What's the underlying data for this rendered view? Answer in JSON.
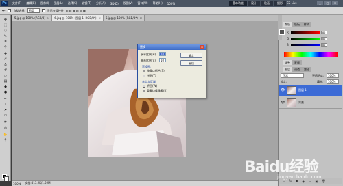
{
  "app": {
    "logo": "Ps",
    "menu": [
      "文件(F)",
      "编辑(E)",
      "图像(I)",
      "图层(L)",
      "选择(S)",
      "滤镜(T)",
      "分析(A)",
      "3D(D)",
      "视图(V)",
      "窗口(W)",
      "帮助(H)"
    ],
    "zoom": "100%",
    "workspaces": [
      "基本功能",
      "设计",
      "绘画",
      "摄影"
    ],
    "active_workspace": "基本功能",
    "cslive": "CS Live",
    "window_controls": [
      "_",
      "□",
      "×"
    ]
  },
  "options_bar": {
    "auto_select_label": "自动选择:",
    "auto_select_value": "图层",
    "show_transform_label": "显示变换控件"
  },
  "tabs": [
    {
      "label": "5.jpg @ 100% (RGB/8)",
      "active": false
    },
    {
      "label": "6.jpg @ 100% (图层 1, RGB/8*)",
      "active": true
    },
    {
      "label": "6.jpg @ 100% (RGB/8*)",
      "active": false
    }
  ],
  "dialog": {
    "title": "置换",
    "h_scale_label": "水平比例(H)",
    "h_scale_value": "10",
    "v_scale_label": "垂直比例(V)",
    "v_scale_value": "10",
    "displacement_map_label": "置换图:",
    "stretch_to_fit": "伸展以适合(S)",
    "tile": "拼贴(T)",
    "undefined_areas_label": "未定义区域:",
    "wrap_around": "折回(W)",
    "repeat_edge_pixels": "重复边缘像素(R)",
    "ok": "确定",
    "cancel": "复位"
  },
  "status_bar": {
    "zoom": "100%",
    "doc_info": "文档:313.2K/1.02M"
  },
  "panels": {
    "color_tabs": [
      "颜色",
      "色板",
      "样式"
    ],
    "sliders": [
      {
        "label": "R",
        "value": "82"
      },
      {
        "label": "G",
        "value": "82"
      },
      {
        "label": "B",
        "value": "82"
      }
    ],
    "adjust_tabs": [
      "调整",
      "蒙版"
    ],
    "layers_tabs": [
      "图层",
      "通道",
      "路径"
    ],
    "blend_mode": "正常",
    "opacity_label": "不透明度:",
    "opacity_value": "100%",
    "lock_label": "锁定:",
    "fill_label": "填充:",
    "fill_value": "100%",
    "layers": [
      {
        "name": "图层 1",
        "selected": true
      },
      {
        "name": "背景",
        "selected": false
      }
    ]
  },
  "watermark": {
    "brand": "Baidu经验",
    "url": "jingyan.baidu.com"
  },
  "colors": {
    "accent": "#3c6bd6",
    "canvas_bg": "#a5a5a5"
  }
}
